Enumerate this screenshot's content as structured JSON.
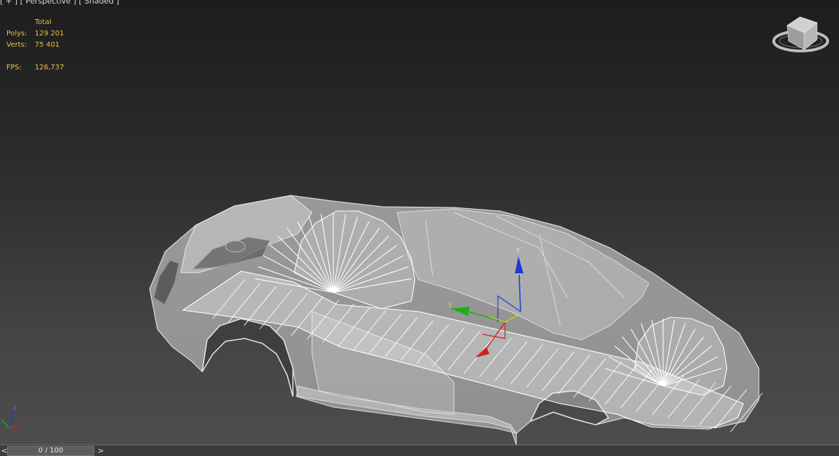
{
  "viewport": {
    "label_plus": "[ + ]",
    "label_view": "[ Perspective ]",
    "label_shading": "[ Shaded ]"
  },
  "stats": {
    "total_label": "Total",
    "polys_label": "Polys:",
    "polys_value": "129 201",
    "verts_label": "Verts:",
    "verts_value": "75 401",
    "fps_label": "FPS:",
    "fps_value": "126,737"
  },
  "gizmo": {
    "z_label": "z",
    "y_label": "y"
  },
  "corner_axis": {
    "z_label": "z"
  },
  "timeline": {
    "prev": "<",
    "slider_text": "0 / 100",
    "next": ">"
  },
  "colors": {
    "stat_text": "#e7c14a",
    "axis_x": "#d42020",
    "axis_y": "#18b018",
    "axis_z": "#1c3ad8",
    "gizmo_y_label": "#d8d800"
  },
  "icons": [
    "viewcube-icon",
    "transform-gizmo-icon",
    "world-axis-tripod-icon"
  ]
}
